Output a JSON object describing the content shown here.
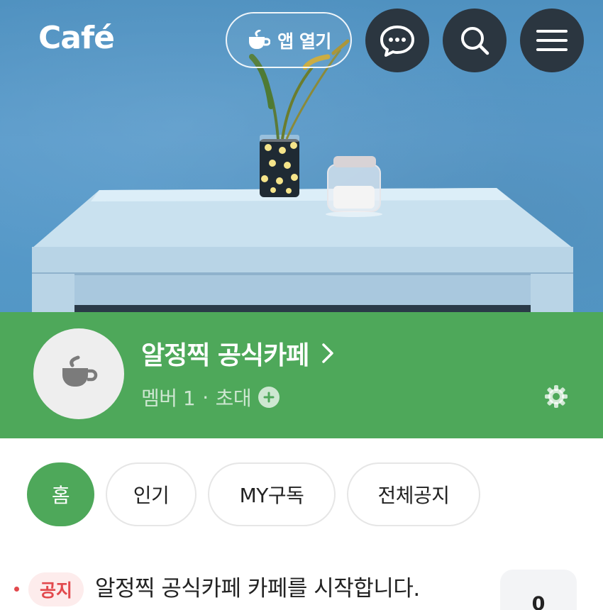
{
  "header": {
    "logo_text": "Café",
    "open_app_label": "앱 열기",
    "icons": [
      "chat-icon",
      "search-icon",
      "menu-icon"
    ]
  },
  "cafe": {
    "name": "알정찍 공식카페",
    "members_text": "멤버 1",
    "separator": "·",
    "invite_label": "초대"
  },
  "tabs": [
    {
      "label": "홈",
      "active": true
    },
    {
      "label": "인기",
      "active": false
    },
    {
      "label": "MY구독",
      "active": false
    },
    {
      "label": "전체공지",
      "active": false
    }
  ],
  "notice": {
    "badge": "공지",
    "title": "알정찍 공식카페 카페를 시작합니다.",
    "count": "0"
  },
  "colors": {
    "brand_green": "#4ea85a",
    "dark_button": "#2b3640",
    "notice_red": "#e2494d"
  }
}
